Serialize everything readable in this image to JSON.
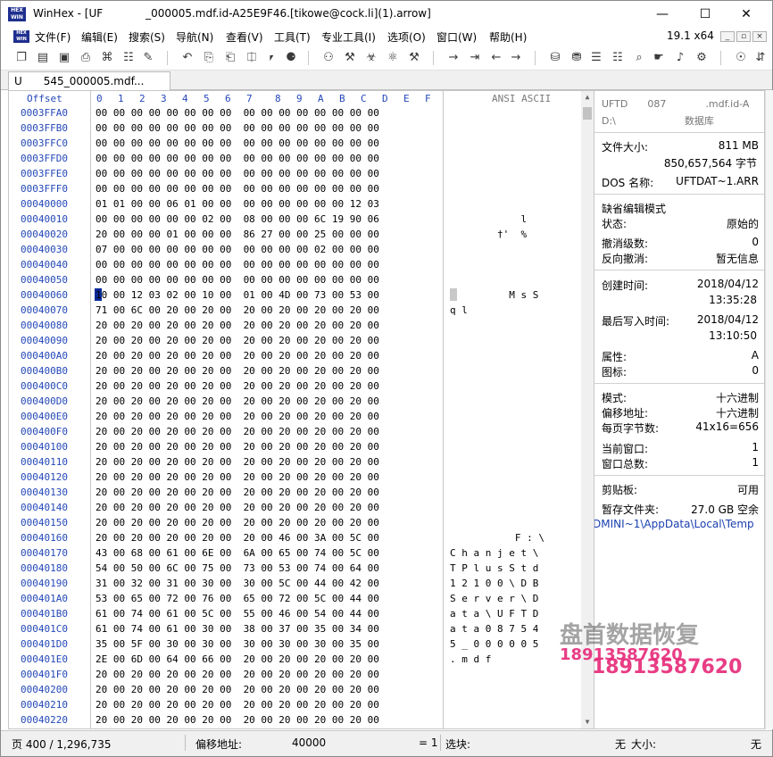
{
  "window": {
    "title": "WinHex - [UF    _000005.mdf.id-A25E9F46.[tikowe@cock.li](1).arrow]",
    "minimize": "—",
    "maximize": "☐",
    "close": "✕"
  },
  "menu": {
    "items": [
      "文件(F)",
      "编辑(E)",
      "搜索(S)",
      "导航(N)",
      "查看(V)",
      "工具(T)",
      "专业工具(I)",
      "选项(O)",
      "窗口(W)",
      "帮助(H)"
    ],
    "version": "19.1 x64",
    "mini_buttons": [
      "_",
      "▫",
      "×"
    ]
  },
  "toolbar": {
    "icons": [
      "new-file-icon",
      "open-folder-icon",
      "save-icon",
      "print-icon",
      "print-preview-icon",
      "properties-icon",
      "edit-icon",
      "undo-icon",
      "copy-icon",
      "paste-icon",
      "paste-new-icon",
      "clipboard-icon",
      "convert-icon",
      "find-text-icon",
      "find-hex-icon",
      "replace-text-icon",
      "replace-hex-icon",
      "find-hex2-icon",
      "goto-icon",
      "goto-offset-icon",
      "back-icon",
      "forward-icon",
      "disk-icon",
      "ram-icon",
      "partition-icon",
      "calculator-icon",
      "zoom-icon",
      "hand-icon",
      "sound-icon",
      "settings-icon",
      "options-icon",
      "extra-icon"
    ],
    "glyphs": [
      "❐",
      "▤",
      "▣",
      "⎙",
      "⌘",
      "☷",
      "✎",
      "↶",
      "⎘",
      "⎗",
      "⎅",
      "⎖",
      "⚈",
      "⚇",
      "⚒",
      "☣",
      "⚛",
      "⚒",
      "→",
      "⇥",
      "←",
      "→",
      "⛁",
      "⛃",
      "☰",
      "☷",
      "⌕",
      "☛",
      "♪",
      "⚙",
      "☉",
      "⇵"
    ]
  },
  "tab": {
    "label": "U  545_000005.mdf..."
  },
  "hex": {
    "offset_header": "Offset",
    "columns": [
      "0",
      "1",
      "2",
      "3",
      "4",
      "5",
      "6",
      "7",
      "8",
      "9",
      "A",
      "B",
      "C",
      "D",
      "E",
      "F"
    ],
    "ansi_header": "ANSI ASCII",
    "rows": [
      {
        "offset": "0003FFA0",
        "bytes": "00 00 00 00 00 00 00 00  00 00 00 00 00 00 00 00",
        "ansi": ""
      },
      {
        "offset": "0003FFB0",
        "bytes": "00 00 00 00 00 00 00 00  00 00 00 00 00 00 00 00",
        "ansi": ""
      },
      {
        "offset": "0003FFC0",
        "bytes": "00 00 00 00 00 00 00 00  00 00 00 00 00 00 00 00",
        "ansi": ""
      },
      {
        "offset": "0003FFD0",
        "bytes": "00 00 00 00 00 00 00 00  00 00 00 00 00 00 00 00",
        "ansi": ""
      },
      {
        "offset": "0003FFE0",
        "bytes": "00 00 00 00 00 00 00 00  00 00 00 00 00 00 00 00",
        "ansi": ""
      },
      {
        "offset": "0003FFF0",
        "bytes": "00 00 00 00 00 00 00 00  00 00 00 00 00 00 00 00",
        "ansi": ""
      },
      {
        "offset": "00040000",
        "bytes": "01 01 00 00 06 01 00 00  00 00 00 00 00 00 12 03",
        "ansi": ""
      },
      {
        "offset": "00040010",
        "bytes": "00 00 00 00 00 00 02 00  08 00 00 00 6C 19 90 06",
        "ansi": "            l"
      },
      {
        "offset": "00040020",
        "bytes": "20 00 00 00 01 00 00 00  86 27 00 00 25 00 00 00",
        "ansi": "        †'  %"
      },
      {
        "offset": "00040030",
        "bytes": "07 00 00 00 00 00 00 00  00 00 00 00 02 00 00 00",
        "ansi": ""
      },
      {
        "offset": "00040040",
        "bytes": "00 00 00 00 00 00 00 00  00 00 00 00 00 00 00 00",
        "ansi": ""
      },
      {
        "offset": "00040050",
        "bytes": "00 00 00 00 00 00 00 00  00 00 00 00 00 00 00 00",
        "ansi": ""
      },
      {
        "offset": "00040060",
        "bytes": "10 00 12 03 02 00 10 00  01 00 4D 00 73 00 53 00",
        "ansi": "          M s S"
      },
      {
        "offset": "00040070",
        "bytes": "71 00 6C 00 20 00 20 00  20 00 20 00 20 00 20 00",
        "ansi": "q l"
      },
      {
        "offset": "00040080",
        "bytes": "20 00 20 00 20 00 20 00  20 00 20 00 20 00 20 00",
        "ansi": ""
      },
      {
        "offset": "00040090",
        "bytes": "20 00 20 00 20 00 20 00  20 00 20 00 20 00 20 00",
        "ansi": ""
      },
      {
        "offset": "000400A0",
        "bytes": "20 00 20 00 20 00 20 00  20 00 20 00 20 00 20 00",
        "ansi": ""
      },
      {
        "offset": "000400B0",
        "bytes": "20 00 20 00 20 00 20 00  20 00 20 00 20 00 20 00",
        "ansi": ""
      },
      {
        "offset": "000400C0",
        "bytes": "20 00 20 00 20 00 20 00  20 00 20 00 20 00 20 00",
        "ansi": ""
      },
      {
        "offset": "000400D0",
        "bytes": "20 00 20 00 20 00 20 00  20 00 20 00 20 00 20 00",
        "ansi": ""
      },
      {
        "offset": "000400E0",
        "bytes": "20 00 20 00 20 00 20 00  20 00 20 00 20 00 20 00",
        "ansi": ""
      },
      {
        "offset": "000400F0",
        "bytes": "20 00 20 00 20 00 20 00  20 00 20 00 20 00 20 00",
        "ansi": ""
      },
      {
        "offset": "00040100",
        "bytes": "20 00 20 00 20 00 20 00  20 00 20 00 20 00 20 00",
        "ansi": ""
      },
      {
        "offset": "00040110",
        "bytes": "20 00 20 00 20 00 20 00  20 00 20 00 20 00 20 00",
        "ansi": ""
      },
      {
        "offset": "00040120",
        "bytes": "20 00 20 00 20 00 20 00  20 00 20 00 20 00 20 00",
        "ansi": ""
      },
      {
        "offset": "00040130",
        "bytes": "20 00 20 00 20 00 20 00  20 00 20 00 20 00 20 00",
        "ansi": ""
      },
      {
        "offset": "00040140",
        "bytes": "20 00 20 00 20 00 20 00  20 00 20 00 20 00 20 00",
        "ansi": ""
      },
      {
        "offset": "00040150",
        "bytes": "20 00 20 00 20 00 20 00  20 00 20 00 20 00 20 00",
        "ansi": ""
      },
      {
        "offset": "00040160",
        "bytes": "20 00 20 00 20 00 20 00  20 00 46 00 3A 00 5C 00",
        "ansi": "           F : \\"
      },
      {
        "offset": "00040170",
        "bytes": "43 00 68 00 61 00 6E 00  6A 00 65 00 74 00 5C 00",
        "ansi": "C h a n j e t \\"
      },
      {
        "offset": "00040180",
        "bytes": "54 00 50 00 6C 00 75 00  73 00 53 00 74 00 64 00",
        "ansi": "T P l u s S t d"
      },
      {
        "offset": "00040190",
        "bytes": "31 00 32 00 31 00 30 00  30 00 5C 00 44 00 42 00",
        "ansi": "1 2 1 0 0 \\ D B"
      },
      {
        "offset": "000401A0",
        "bytes": "53 00 65 00 72 00 76 00  65 00 72 00 5C 00 44 00",
        "ansi": "S e r v e r \\ D"
      },
      {
        "offset": "000401B0",
        "bytes": "61 00 74 00 61 00 5C 00  55 00 46 00 54 00 44 00",
        "ansi": "a t a \\ U F T D"
      },
      {
        "offset": "000401C0",
        "bytes": "61 00 74 00 61 00 30 00  38 00 37 00 35 00 34 00",
        "ansi": "a t a 0 8 7 5 4"
      },
      {
        "offset": "000401D0",
        "bytes": "35 00 5F 00 30 00 30 00  30 00 30 00 30 00 35 00",
        "ansi": "5 _ 0 0 0 0 0 5"
      },
      {
        "offset": "000401E0",
        "bytes": "2E 00 6D 00 64 00 66 00  20 00 20 00 20 00 20 00",
        "ansi": ". m d f"
      },
      {
        "offset": "000401F0",
        "bytes": "20 00 20 00 20 00 20 00  20 00 20 00 20 00 20 00",
        "ansi": ""
      },
      {
        "offset": "00040200",
        "bytes": "20 00 20 00 20 00 20 00  20 00 20 00 20 00 20 00",
        "ansi": ""
      },
      {
        "offset": "00040210",
        "bytes": "20 00 20 00 20 00 20 00  20 00 20 00 20 00 20 00",
        "ansi": ""
      },
      {
        "offset": "00040220",
        "bytes": "20 00 20 00 20 00 20 00  20 00 20 00 20 00 20 00",
        "ansi": ""
      }
    ]
  },
  "info": {
    "file_name_line1": "UFTD  087    .mdf.id-A",
    "file_name_line2": "D:\\       数据库",
    "file_size_label": "文件大小:",
    "file_size_mb": "811 MB",
    "file_size_bytes": "850,657,564 字节",
    "dos_name_label": "DOS 名称:",
    "dos_name": "UFTDAT~1.ARR",
    "edit_mode_title": "缺省编辑模式",
    "state_label": "状态:",
    "state_value": "原始的",
    "undo_level_label": "撤消级数:",
    "undo_level_value": "0",
    "reverse_undo_label": "反向撤消:",
    "reverse_undo_value": "暂无信息",
    "created_label": "创建时间:",
    "created_date": "2018/04/12",
    "created_time": "13:35:28",
    "modified_label": "最后写入时间:",
    "modified_date": "2018/04/12",
    "modified_time": "13:10:50",
    "attr_label": "属性:",
    "attr_value": "A",
    "icon_label": "图标:",
    "icon_value": "0",
    "mode_label": "模式:",
    "mode_value": "十六进制",
    "offset_addr_label": "偏移地址:",
    "offset_addr_value": "十六进制",
    "bytes_per_page_label": "每页字节数:",
    "bytes_per_page_value": "41x16=656",
    "current_window_label": "当前窗口:",
    "current_window_value": "1",
    "window_total_label": "窗口总数:",
    "window_total_value": "1",
    "clipboard_label": "剪贴板:",
    "clipboard_value": "可用",
    "temp_folder_label": "暂存文件夹:",
    "temp_folder_value": "27.0 GB 空余",
    "temp_path": "DMINI~1\\AppData\\Local\\Temp"
  },
  "status": {
    "page": "页 400 / 1,296,735",
    "offset_label": "偏移地址:",
    "offset_value": "40000",
    "equals": "= 1",
    "selection_label": "选块:",
    "size_label": "无",
    "size_text": "大小:",
    "tail": "无"
  },
  "watermark": {
    "line1": "盘首数据恢复",
    "line2": "18913587620",
    "line3": "18913587620"
  }
}
